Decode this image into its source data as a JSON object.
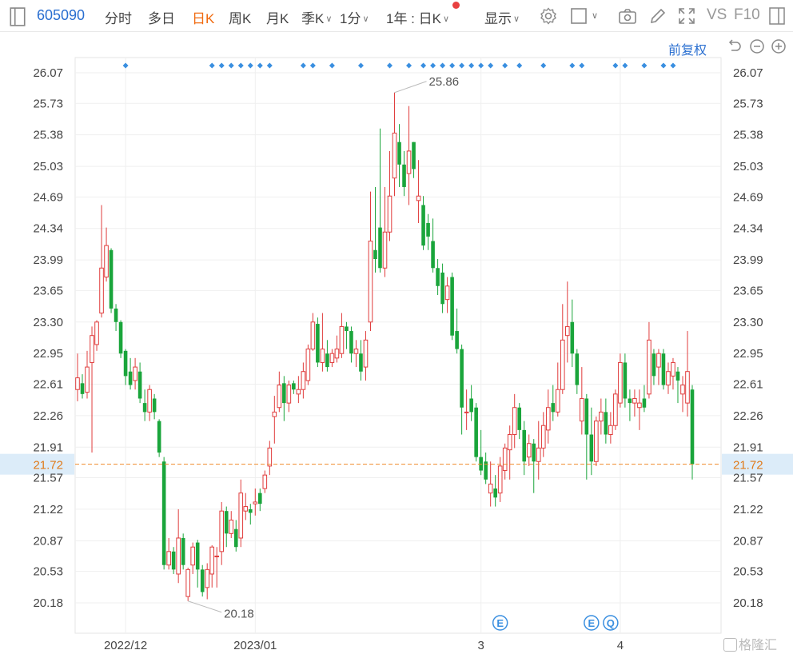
{
  "toolbar": {
    "stock_code": "605090",
    "periods": [
      "分时",
      "多日",
      "日K",
      "周K",
      "月K",
      "季K",
      "1分",
      "1年 : 日K"
    ],
    "active_period": "日K",
    "display_label": "显示",
    "vs_label": "VS",
    "f10_label": "F10"
  },
  "adjust_label": "前复权",
  "watermark": "格隆汇",
  "chart_data": {
    "type": "candlestick",
    "y_ticks": [
      "26.07",
      "25.73",
      "25.38",
      "25.03",
      "24.69",
      "24.34",
      "23.99",
      "23.65",
      "23.30",
      "22.95",
      "22.61",
      "22.26",
      "21.91",
      "21.57",
      "21.22",
      "20.87",
      "20.53",
      "20.18"
    ],
    "ylim": [
      20.18,
      26.07
    ],
    "x_ticks": [
      "2022/12",
      "2023/01",
      "3",
      "4"
    ],
    "x_tick_positions": [
      10,
      37,
      84,
      113
    ],
    "current_price": "21.72",
    "max_label": "25.86",
    "min_label": "20.18",
    "event_markers": [
      "E",
      "E",
      "Q"
    ],
    "colors": {
      "up": "#e03c3c",
      "down": "#1aa53b",
      "current_line": "#f08a2a",
      "marker": "#3a8fe0",
      "highlight": "#dcecf9"
    },
    "candles": [
      [
        22.55,
        22.68,
        22.42,
        22.95
      ],
      [
        22.62,
        22.5,
        22.45,
        22.72
      ],
      [
        22.52,
        22.8,
        22.45,
        22.98
      ],
      [
        22.85,
        23.15,
        21.85,
        23.25
      ],
      [
        23.05,
        23.3,
        22.98,
        23.32
      ],
      [
        23.4,
        23.9,
        23.35,
        24.6
      ],
      [
        23.8,
        24.15,
        23.75,
        24.35
      ],
      [
        24.1,
        23.45,
        23.4,
        24.12
      ],
      [
        23.45,
        23.3,
        23.2,
        23.5
      ],
      [
        23.3,
        22.95,
        22.9,
        23.32
      ],
      [
        22.98,
        22.7,
        22.6,
        23.0
      ],
      [
        22.75,
        22.6,
        22.55,
        22.9
      ],
      [
        22.65,
        22.8,
        22.55,
        22.9
      ],
      [
        22.75,
        22.45,
        22.4,
        22.85
      ],
      [
        22.4,
        22.3,
        22.2,
        22.55
      ],
      [
        22.3,
        22.55,
        22.2,
        22.6
      ],
      [
        22.45,
        22.3,
        22.22,
        22.5
      ],
      [
        22.2,
        21.85,
        21.8,
        22.22
      ],
      [
        21.75,
        20.6,
        20.55,
        21.8
      ],
      [
        20.6,
        20.75,
        20.55,
        20.9
      ],
      [
        20.75,
        20.55,
        20.5,
        20.8
      ],
      [
        20.5,
        20.9,
        20.4,
        21.22
      ],
      [
        20.9,
        20.6,
        20.55,
        20.95
      ],
      [
        20.25,
        20.55,
        20.2,
        20.57
      ],
      [
        20.6,
        20.8,
        20.5,
        20.85
      ],
      [
        20.85,
        20.55,
        20.35,
        20.88
      ],
      [
        20.55,
        20.3,
        20.25,
        20.6
      ],
      [
        20.35,
        20.55,
        20.22,
        20.62
      ],
      [
        20.5,
        20.8,
        20.35,
        20.82
      ],
      [
        20.7,
        20.7,
        20.35,
        20.8
      ],
      [
        20.75,
        21.2,
        20.6,
        21.3
      ],
      [
        21.2,
        20.95,
        20.8,
        21.25
      ],
      [
        20.95,
        21.1,
        20.9,
        21.2
      ],
      [
        21.0,
        20.8,
        20.75,
        21.1
      ],
      [
        20.9,
        21.4,
        20.8,
        21.55
      ],
      [
        21.2,
        21.25,
        21.1,
        21.4
      ],
      [
        21.22,
        21.18,
        21.05,
        21.28
      ],
      [
        21.28,
        21.3,
        21.15,
        21.45
      ],
      [
        21.4,
        21.28,
        21.2,
        21.45
      ],
      [
        21.45,
        21.6,
        21.4,
        21.65
      ],
      [
        21.7,
        21.9,
        21.6,
        21.98
      ],
      [
        22.25,
        22.3,
        21.95,
        22.48
      ],
      [
        22.35,
        22.6,
        22.3,
        22.75
      ],
      [
        22.62,
        22.4,
        22.2,
        22.7
      ],
      [
        22.4,
        22.6,
        22.3,
        22.65
      ],
      [
        22.62,
        22.55,
        22.5,
        22.65
      ],
      [
        22.5,
        22.55,
        22.4,
        22.7
      ],
      [
        22.55,
        22.75,
        22.45,
        22.85
      ],
      [
        22.65,
        23.0,
        22.6,
        23.05
      ],
      [
        23.0,
        23.3,
        22.98,
        23.4
      ],
      [
        23.28,
        22.85,
        22.8,
        23.35
      ],
      [
        22.85,
        23.0,
        22.75,
        23.4
      ],
      [
        22.95,
        22.8,
        22.75,
        23.1
      ],
      [
        22.85,
        22.95,
        22.8,
        23.0
      ],
      [
        22.9,
        23.0,
        22.85,
        23.15
      ],
      [
        22.95,
        23.25,
        22.9,
        23.4
      ],
      [
        23.25,
        23.2,
        23.0,
        23.3
      ],
      [
        23.2,
        22.95,
        22.85,
        23.25
      ],
      [
        22.95,
        23.0,
        22.8,
        23.1
      ],
      [
        22.95,
        22.75,
        22.65,
        23.1
      ],
      [
        22.8,
        23.1,
        22.65,
        23.2
      ],
      [
        23.3,
        24.2,
        23.2,
        24.75
      ],
      [
        24.1,
        24.0,
        23.85,
        24.8
      ],
      [
        24.35,
        23.9,
        23.85,
        25.45
      ],
      [
        23.9,
        24.3,
        23.8,
        24.8
      ],
      [
        24.3,
        24.7,
        24.2,
        25.2
      ],
      [
        24.9,
        25.4,
        24.7,
        25.85
      ],
      [
        25.3,
        25.05,
        24.8,
        25.5
      ],
      [
        25.05,
        24.8,
        24.7,
        25.2
      ],
      [
        24.95,
        25.2,
        24.6,
        25.7
      ],
      [
        25.3,
        25.0,
        24.9,
        25.3
      ],
      [
        24.65,
        24.7,
        24.4,
        25.1
      ],
      [
        24.6,
        24.15,
        24.1,
        24.7
      ],
      [
        24.4,
        24.25,
        24.1,
        24.5
      ],
      [
        24.2,
        23.9,
        23.85,
        24.45
      ],
      [
        23.9,
        23.7,
        23.6,
        24.0
      ],
      [
        23.85,
        23.5,
        23.4,
        23.95
      ],
      [
        23.55,
        23.7,
        23.4,
        23.8
      ],
      [
        23.8,
        23.15,
        23.1,
        23.85
      ],
      [
        23.2,
        23.0,
        22.95,
        23.45
      ],
      [
        23.0,
        22.35,
        22.05,
        23.05
      ],
      [
        22.3,
        22.3,
        22.1,
        22.55
      ],
      [
        22.45,
        22.3,
        22.2,
        22.6
      ],
      [
        22.35,
        21.8,
        21.75,
        22.4
      ],
      [
        21.8,
        21.65,
        21.6,
        22.1
      ],
      [
        21.75,
        21.55,
        21.5,
        21.85
      ],
      [
        21.4,
        21.5,
        21.25,
        21.75
      ],
      [
        21.45,
        21.35,
        21.25,
        21.6
      ],
      [
        21.4,
        21.7,
        21.3,
        21.8
      ],
      [
        21.65,
        21.9,
        21.55,
        21.95
      ],
      [
        21.88,
        22.05,
        21.55,
        22.15
      ],
      [
        22.05,
        22.35,
        21.9,
        22.5
      ],
      [
        22.35,
        22.1,
        22.0,
        22.4
      ],
      [
        22.1,
        21.75,
        21.6,
        22.2
      ],
      [
        21.8,
        21.95,
        21.7,
        22.05
      ],
      [
        21.95,
        21.75,
        21.4,
        22.0
      ],
      [
        21.75,
        21.9,
        21.55,
        22.2
      ],
      [
        21.9,
        22.15,
        21.8,
        22.3
      ],
      [
        22.1,
        22.35,
        21.95,
        22.55
      ],
      [
        22.4,
        22.3,
        22.2,
        22.6
      ],
      [
        22.3,
        22.55,
        22.25,
        22.85
      ],
      [
        22.55,
        23.1,
        22.5,
        23.5
      ],
      [
        23.15,
        23.25,
        22.85,
        23.75
      ],
      [
        23.3,
        22.95,
        22.8,
        23.55
      ],
      [
        22.95,
        22.6,
        22.5,
        23.0
      ],
      [
        22.2,
        22.45,
        22.05,
        22.8
      ],
      [
        22.45,
        22.05,
        21.55,
        22.5
      ],
      [
        22.05,
        21.75,
        21.6,
        22.35
      ],
      [
        21.75,
        22.2,
        21.7,
        22.25
      ],
      [
        22.2,
        22.3,
        22.05,
        22.45
      ],
      [
        22.3,
        22.05,
        21.95,
        22.45
      ],
      [
        22.05,
        22.15,
        21.95,
        22.3
      ],
      [
        22.15,
        22.5,
        22.1,
        22.55
      ],
      [
        22.4,
        22.85,
        22.35,
        22.95
      ],
      [
        22.85,
        22.45,
        22.35,
        22.95
      ],
      [
        22.45,
        22.4,
        22.2,
        22.55
      ],
      [
        22.4,
        22.45,
        22.25,
        22.55
      ],
      [
        22.35,
        22.4,
        22.1,
        22.55
      ],
      [
        22.45,
        22.35,
        22.3,
        22.6
      ],
      [
        22.5,
        23.1,
        22.45,
        23.3
      ],
      [
        22.95,
        22.7,
        22.6,
        23.0
      ],
      [
        22.8,
        22.95,
        22.6,
        23.0
      ],
      [
        22.95,
        22.6,
        22.55,
        23.0
      ],
      [
        22.6,
        22.75,
        22.5,
        22.85
      ],
      [
        22.7,
        22.85,
        22.55,
        22.9
      ],
      [
        22.75,
        22.65,
        22.4,
        22.8
      ],
      [
        22.5,
        22.6,
        22.3,
        22.7
      ],
      [
        22.4,
        22.75,
        22.25,
        23.2
      ],
      [
        22.55,
        21.72,
        21.55,
        22.6
      ]
    ]
  }
}
